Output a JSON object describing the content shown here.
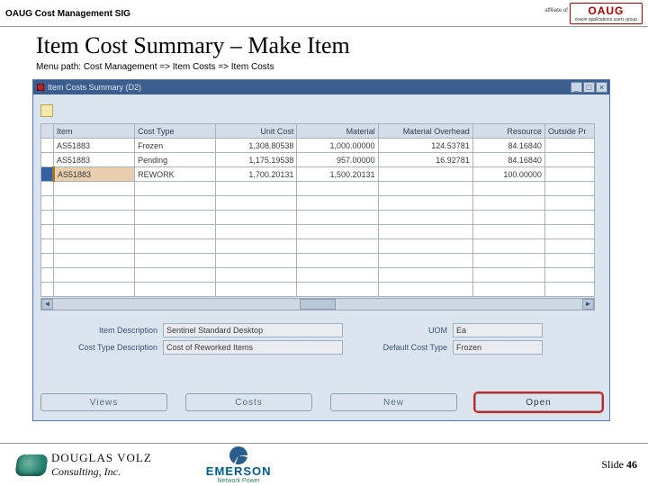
{
  "header": {
    "sig_label": "OAUG Cost Management SIG",
    "affiliate_tag": "affiliate of",
    "oaug_big": "OAUG",
    "oaug_small": "oracle applications users group"
  },
  "title": "Item Cost Summary – Make Item",
  "menu_path": "Menu path:  Cost Management => Item Costs => Item Costs",
  "window": {
    "title": "Item Costs Summary (D2)",
    "columns": [
      "Item",
      "Cost Type",
      "Unit Cost",
      "Material",
      "Material Overhead",
      "Resource",
      "Outside Pr"
    ],
    "rows": [
      {
        "item": "AS51883",
        "cost_type": "Frozen",
        "unit_cost": "1,308.80538",
        "material": "1,000.00000",
        "moh": "124.53781",
        "resource": "84.16840"
      },
      {
        "item": "AS51883",
        "cost_type": "Pending",
        "unit_cost": "1,175.19538",
        "material": "957.00000",
        "moh": "16.92781",
        "resource": "84.16840"
      },
      {
        "item": "AS51883",
        "cost_type": "REWORK",
        "unit_cost": "1,700.20131",
        "material": "1,500.20131",
        "moh": "",
        "resource": "100.00000"
      }
    ],
    "blank_rows": 8,
    "detail": {
      "item_desc_label": "Item Description",
      "item_desc_value": "Sentinel Standard Desktop",
      "cost_type_desc_label": "Cost Type Description",
      "cost_type_desc_value": "Cost of Reworked Items",
      "uom_label": "UOM",
      "uom_value": "Ea",
      "default_ct_label": "Default Cost Type",
      "default_ct_value": "Frozen"
    },
    "buttons": {
      "views": "Views",
      "costs": "Costs",
      "new": "New",
      "open": "Open"
    }
  },
  "footer": {
    "dv_line1": "DOUGLAS VOLZ",
    "dv_line2": "Consulting, Inc.",
    "emerson_name": "EMERSON",
    "emerson_sub": "Network Power",
    "slide_label": "Slide ",
    "slide_number": "46"
  }
}
